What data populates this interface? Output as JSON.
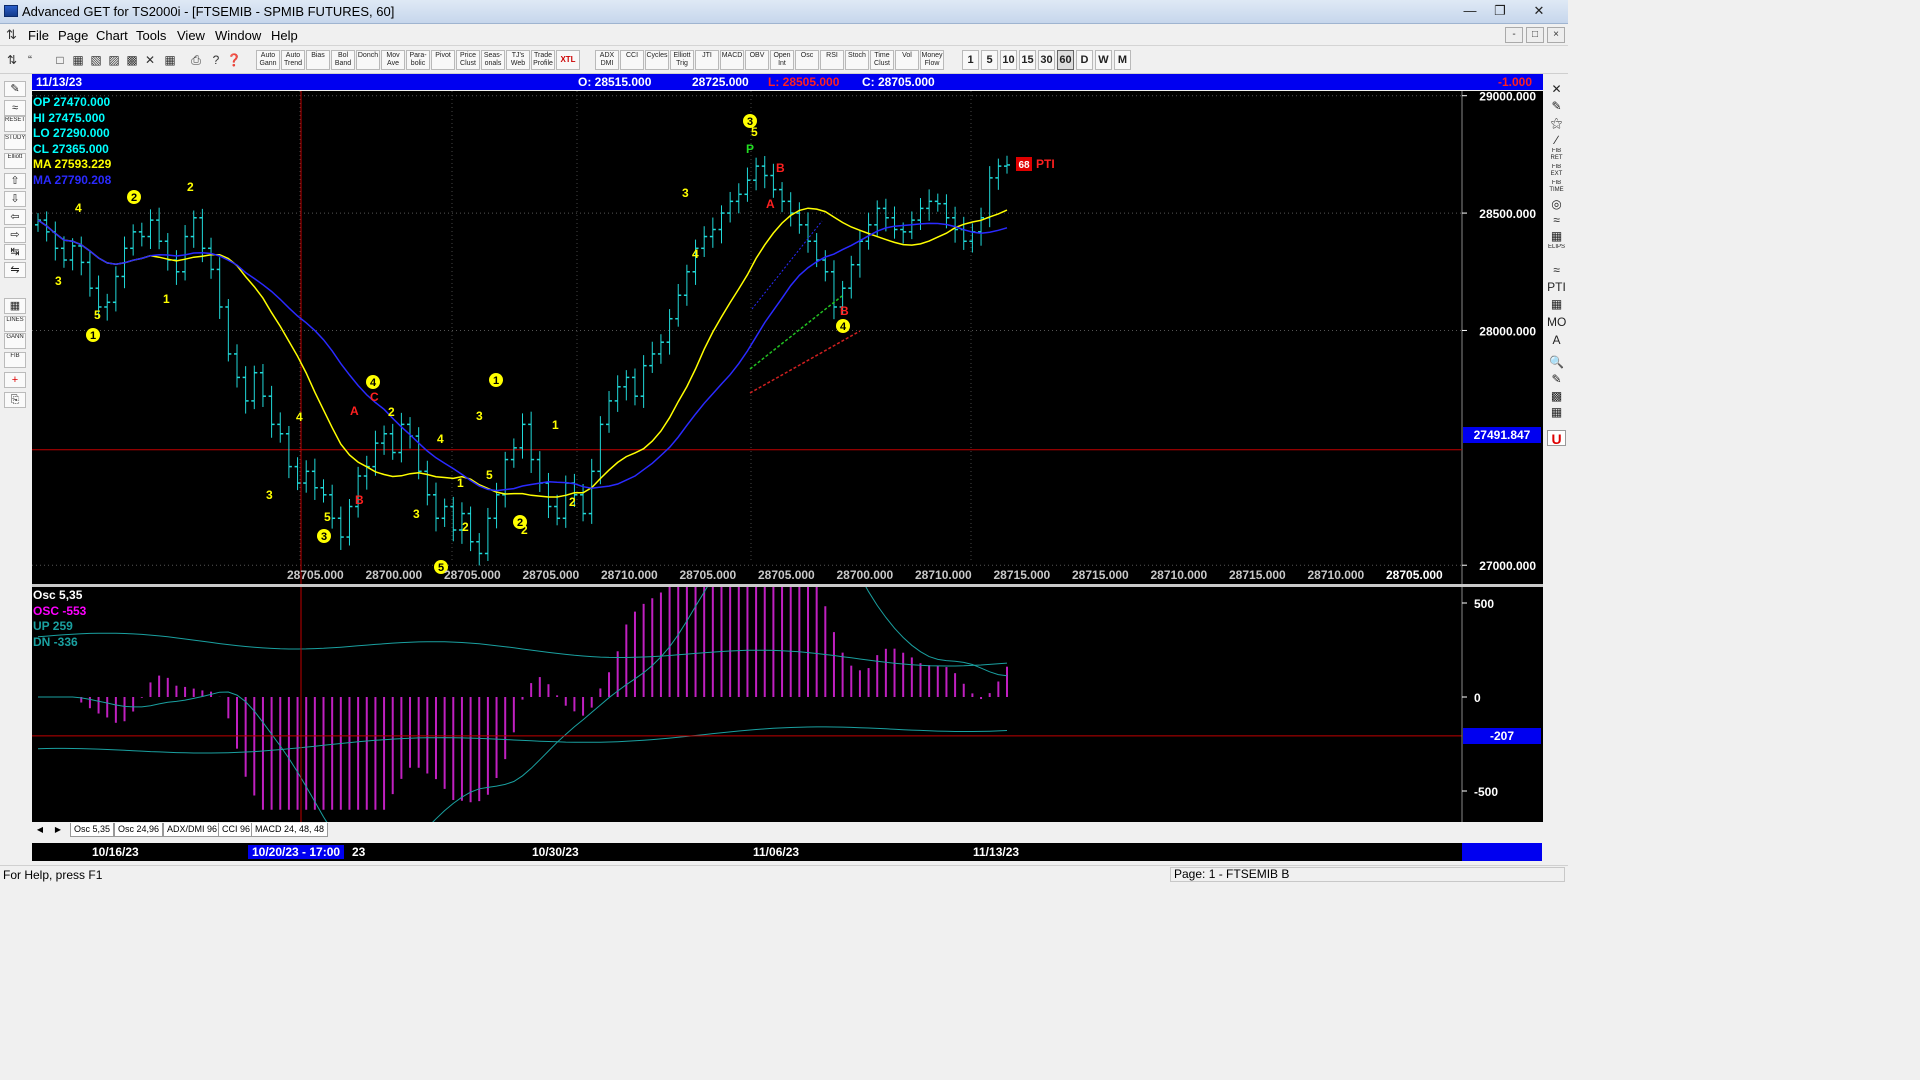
{
  "window": {
    "title": "Advanced GET for TS2000i - [FTSEMIB - SPMIB FUTURES, 60]"
  },
  "menu": [
    "File",
    "Page",
    "Chart",
    "Tools",
    "View",
    "Window",
    "Help"
  ],
  "toolbar": {
    "study_buttons": [
      "Auto Gann",
      "Auto Trend",
      "Bias",
      "Bol Band",
      "Donch",
      "Mov Ave",
      "Para-bolic",
      "Pivot",
      "Price Clust",
      "Seas-onals",
      "TJ's Web",
      "Trade Profile",
      "XTL",
      "ADX DMI",
      "CCI",
      "Cycles",
      "Elliott Trig",
      "JTI",
      "MACD",
      "OBV",
      "Open Int",
      "Osc",
      "RSI",
      "Stoch",
      "Time Clust",
      "Vol",
      "Money Flow"
    ],
    "timeframes": [
      "1",
      "5",
      "10",
      "15",
      "30",
      "60",
      "D",
      "W",
      "M"
    ],
    "selected_timeframe": "60"
  },
  "infobar": {
    "date": "11/13/23",
    "open": "O: 28515.000",
    "high": "28725.000",
    "low": "L: 28505.000",
    "close": "C: 28705.000",
    "change": "-1.000"
  },
  "price_legend": [
    {
      "label": "OP 27470.000",
      "color": "#00ffff"
    },
    {
      "label": "HI  27475.000",
      "color": "#00ffff"
    },
    {
      "label": "LO  27290.000",
      "color": "#00ffff"
    },
    {
      "label": "CL  27365.000",
      "color": "#00ffff"
    },
    {
      "label": "MA  27593.229",
      "color": "#ffff00"
    },
    {
      "label": "MA  27790.208",
      "color": "#2a2aff"
    }
  ],
  "osc_legend": [
    {
      "label": "Osc 5,35",
      "color": "#ffffff"
    },
    {
      "label": "OSC -553",
      "color": "#ff00ff"
    },
    {
      "label": "UP   259",
      "color": "#1aa0a0"
    },
    {
      "label": "DN   -336",
      "color": "#1aa0a0"
    }
  ],
  "pti": {
    "value": "68",
    "label": "PTI"
  },
  "price_axis": {
    "ticks": [
      "29000.000",
      "28500.000",
      "28000.000",
      "27000.000"
    ],
    "cursor_price": "27491.847"
  },
  "osc_axis": {
    "ticks": [
      "500",
      "0",
      "-500"
    ],
    "cursor_value": "-207"
  },
  "pivot_labels": [
    "28705.000",
    "28700.000",
    "28705.000",
    "28705.000",
    "28710.000",
    "28705.000",
    "28705.000",
    "28700.000",
    "28710.000",
    "28715.000",
    "28715.000",
    "28710.000",
    "28715.000",
    "28710.000",
    "28705.000"
  ],
  "tabs": [
    "Osc 5,35",
    "Osc 24,96",
    "ADX/DMI 96",
    "CCI 96",
    "MACD 24, 48, 48"
  ],
  "dates": [
    "10/16/23",
    "10/20/23 - 17:00",
    "23",
    "10/30/23",
    "11/06/23",
    "11/13/23"
  ],
  "status": {
    "help": "For Help, press F1",
    "page": "Page: 1 - FTSEMIB B"
  },
  "chart_data": {
    "type": "candlestick",
    "title": "FTSEMIB - SPMIB FUTURES, 60",
    "x_dates": [
      "10/16/23",
      "10/30/23",
      "11/06/23",
      "11/13/23"
    ],
    "ylim": [
      26920,
      29020
    ],
    "close_series": [
      28470,
      28420,
      28350,
      28300,
      28360,
      28290,
      28180,
      28100,
      28120,
      28230,
      28350,
      28420,
      28400,
      28470,
      28380,
      28300,
      28250,
      28400,
      28480,
      28350,
      28260,
      28100,
      27900,
      27800,
      27700,
      27820,
      27720,
      27600,
      27560,
      27420,
      27350,
      27400,
      27330,
      27300,
      27200,
      27120,
      27250,
      27380,
      27420,
      27520,
      27560,
      27480,
      27600,
      27550,
      27400,
      27300,
      27200,
      27250,
      27150,
      27220,
      27100,
      27050,
      27200,
      27300,
      27450,
      27500,
      27600,
      27450,
      27350,
      27250,
      27200,
      27350,
      27300,
      27220,
      27400,
      27600,
      27700,
      27760,
      27800,
      27720,
      27850,
      27900,
      27950,
      28050,
      28150,
      28250,
      28350,
      28400,
      28430,
      28500,
      28550,
      28580,
      28640,
      28700,
      28660,
      28600,
      28550,
      28500,
      28450,
      28380,
      28300,
      28250,
      28100,
      28180,
      28280,
      28380,
      28450,
      28520,
      28480,
      28430,
      28420,
      28470,
      28520,
      28550,
      28540,
      28480,
      28430,
      28380,
      28420,
      28480,
      28650,
      28700,
      28705
    ],
    "series": [
      {
        "name": "MA 27593.229",
        "color": "#ffff00"
      },
      {
        "name": "MA 27790.208",
        "color": "#2a2aff"
      }
    ],
    "osc": {
      "name": "OSC",
      "ylim": [
        -600,
        600
      ],
      "hline": -207
    }
  }
}
